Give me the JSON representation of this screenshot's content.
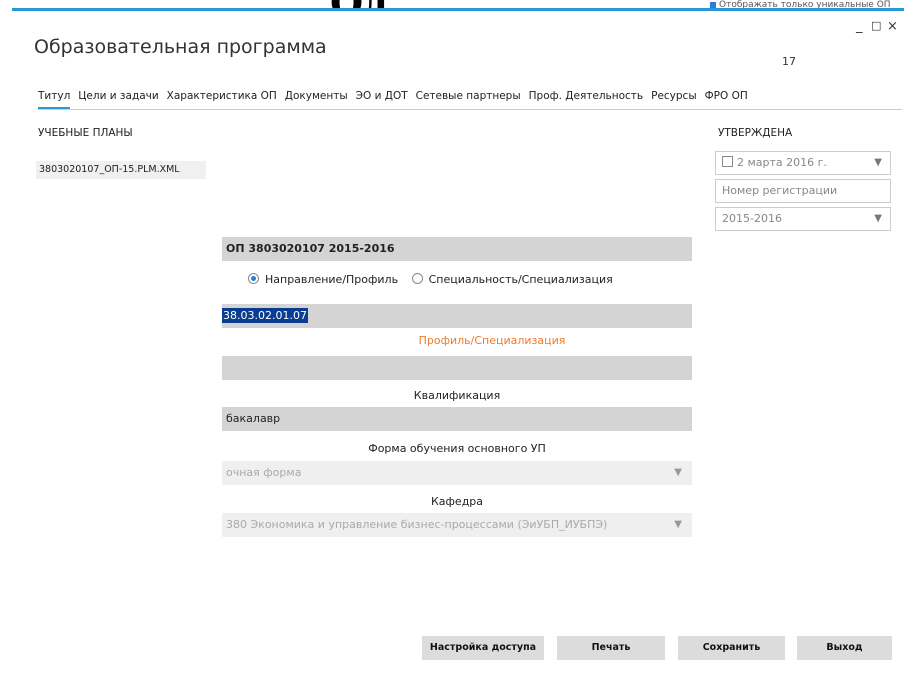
{
  "background": {
    "heading": "Од",
    "checkbox_label": "Отображать только уникальные ОП"
  },
  "window": {
    "title": "Образовательная программа",
    "count": "17",
    "min": "_",
    "max": "□",
    "close": "×"
  },
  "tabs": [
    {
      "label": "Титул"
    },
    {
      "label": "Цели и задачи"
    },
    {
      "label": "Характеристика ОП"
    },
    {
      "label": "Документы"
    },
    {
      "label": "ЭО и ДОТ"
    },
    {
      "label": "Сетевые партнеры"
    },
    {
      "label": "Проф. Деятельность"
    },
    {
      "label": "Ресурсы"
    },
    {
      "label": "ФРО ОП"
    }
  ],
  "plans": {
    "label": "УЧЕБНЫЕ ПЛАНЫ",
    "items": [
      "3803020107_ОП-15.PLM.XML"
    ]
  },
  "approved": {
    "label": "УТВЕРЖДЕНА",
    "date": "2 марта 2016 г.",
    "reg_placeholder": "Номер регистрации",
    "year": "2015-2016"
  },
  "form": {
    "header": "ОП 3803020107 2015-2016",
    "radio1": "Направление/Профиль",
    "radio2": "Специальность/Специализация",
    "code": "38.03.02.01.07",
    "profile_label": "Профиль/Специализация",
    "profile_value": "",
    "qual_label": "Квалификация",
    "qual_value": "бакалавр",
    "form_label": "Форма обучения основного УП",
    "form_value": "очная форма",
    "dept_label": "Кафедра",
    "dept_value": "380 Экономика и управление бизнес-процессами (ЭиУБП_ИУБПЭ)"
  },
  "buttons": {
    "access": "Настройка доступа",
    "print": "Печать",
    "save": "Сохранить",
    "exit": "Выход"
  },
  "colors": {
    "accent": "#2a97d6",
    "orange": "#f07a2a",
    "selection": "#0a3d91"
  }
}
